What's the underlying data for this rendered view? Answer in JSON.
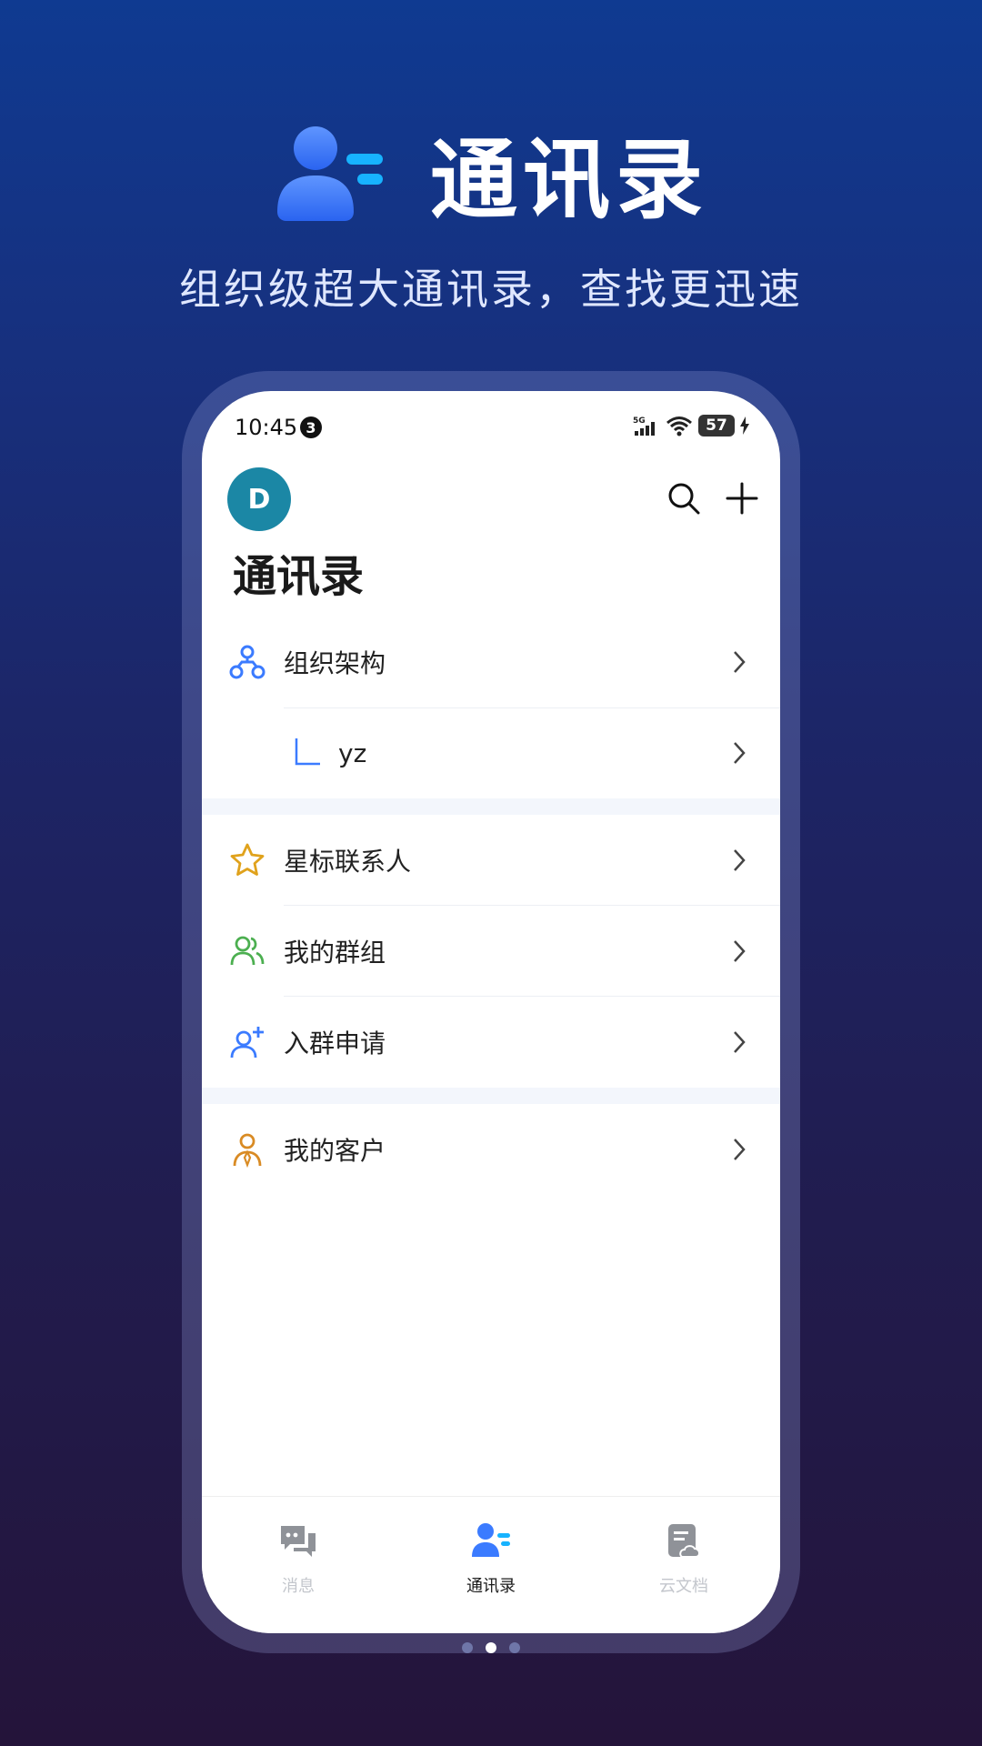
{
  "hero": {
    "title": "通讯录",
    "subtitle": "组织级超大通讯录，查找更迅速"
  },
  "status_bar": {
    "time": "10:45",
    "notification_count": "3",
    "network": "5G",
    "battery": "57"
  },
  "header": {
    "avatar_letter": "D",
    "search_icon": "search-icon",
    "add_icon": "plus-icon"
  },
  "page": {
    "title": "通讯录"
  },
  "list": {
    "org": {
      "label": "组织架构",
      "icon": "org-structure-icon"
    },
    "org_child": {
      "label": "yz",
      "icon": "tree-branch-icon"
    },
    "starred": {
      "label": "星标联系人",
      "icon": "star-icon"
    },
    "groups": {
      "label": "我的群组",
      "icon": "group-icon"
    },
    "join_requests": {
      "label": "入群申请",
      "icon": "add-user-icon"
    },
    "customers": {
      "label": "我的客户",
      "icon": "customer-icon"
    }
  },
  "tabbar": {
    "tabs": [
      {
        "label": "消息",
        "icon": "chat-icon",
        "active": false
      },
      {
        "label": "通讯录",
        "icon": "contacts-icon",
        "active": true
      },
      {
        "label": "云文档",
        "icon": "cloud-doc-icon",
        "active": false
      }
    ]
  },
  "pager": {
    "count": 3,
    "active_index": 1
  },
  "colors": {
    "accent_blue": "#3b7bff",
    "avatar_teal": "#1b87a5",
    "star_gold": "#e0a21c",
    "group_green": "#4caf50",
    "customer_orange": "#d98b24"
  }
}
